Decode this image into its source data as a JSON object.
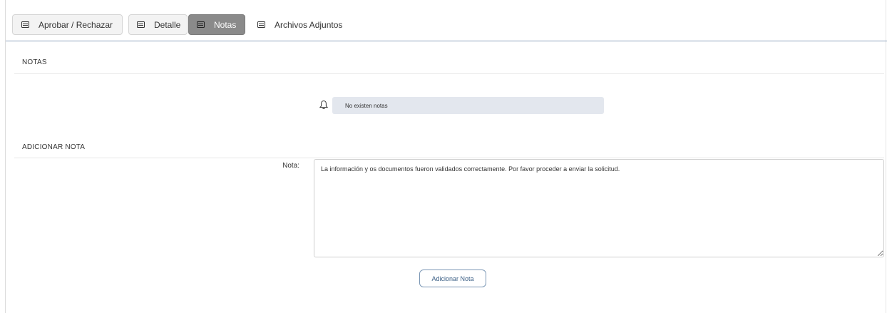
{
  "tabs": [
    {
      "label": "Aprobar / Rechazar",
      "state": "normal"
    },
    {
      "label": "Detalle",
      "state": "normal"
    },
    {
      "label": "Notas",
      "state": "active"
    },
    {
      "label": "Archivos Adjuntos",
      "state": "plain"
    }
  ],
  "notas_section": {
    "title": "NOTAS",
    "empty_message": "No existen notas",
    "icon": "bell-icon"
  },
  "add_section": {
    "title": "ADICIONAR NOTA",
    "field_label": "Nota:",
    "field_value": "La información y os documentos fueron validados correctamente. Por favor proceder a enviar la solicitud.",
    "button_label": "Adicionar Nota"
  },
  "colors": {
    "active_tab": "#8a8a8a",
    "alert_bg": "#e3e7ee",
    "button_border": "#7b97b5",
    "tabbar_border": "#8fa3bd"
  }
}
